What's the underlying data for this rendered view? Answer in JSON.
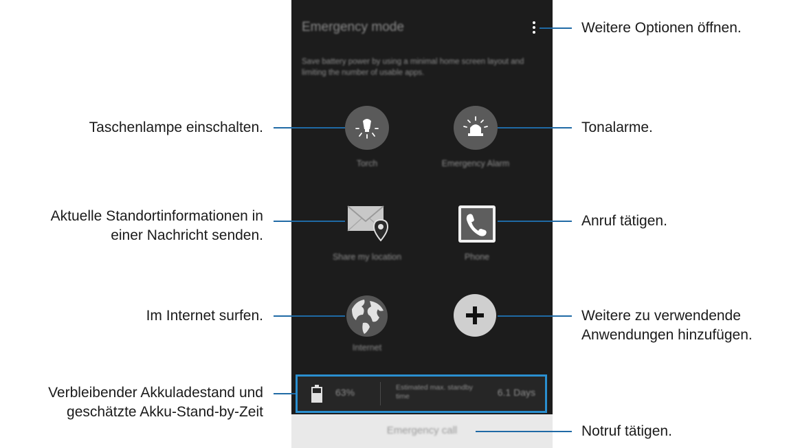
{
  "screen": {
    "title": "Emergency mode",
    "description": "Save battery power by using a minimal home screen layout and limiting the number of usable apps.",
    "apps": [
      {
        "id": "torch",
        "label": "Torch",
        "icon": "flashlight-icon"
      },
      {
        "id": "alarm",
        "label": "Emergency Alarm",
        "icon": "siren-icon"
      },
      {
        "id": "share",
        "label": "Share my location",
        "icon": "envelope-location-icon"
      },
      {
        "id": "phone",
        "label": "Phone",
        "icon": "phone-icon"
      },
      {
        "id": "internet",
        "label": "Internet",
        "icon": "globe-icon"
      },
      {
        "id": "add",
        "label": "",
        "icon": "plus-icon"
      }
    ],
    "battery": {
      "percent": "63%",
      "estimate_label": "Estimated max. standby time",
      "days": "6.1 Days"
    },
    "emergency_call": "Emergency call"
  },
  "callouts": {
    "more_options": "Weitere Optionen öffnen.",
    "torch": "Taschenlampe einschalten.",
    "alarm": "Tonalarme.",
    "share_line1": "Aktuelle Standortinformationen in",
    "share_line2": "einer Nachricht senden.",
    "phone": "Anruf tätigen.",
    "internet": "Im Internet surfen.",
    "add_line1": "Weitere zu verwendende",
    "add_line2": "Anwendungen hinzufügen.",
    "battery_line1": "Verbleibender Akkuladestand und",
    "battery_line2": "geschätzte Akku-Stand-by-Zeit",
    "emergency_call": "Notruf tätigen."
  },
  "colors": {
    "screen_bg": "#1c1c1c",
    "highlight": "#2a8fd0",
    "callout_line": "#1f6aa5"
  }
}
